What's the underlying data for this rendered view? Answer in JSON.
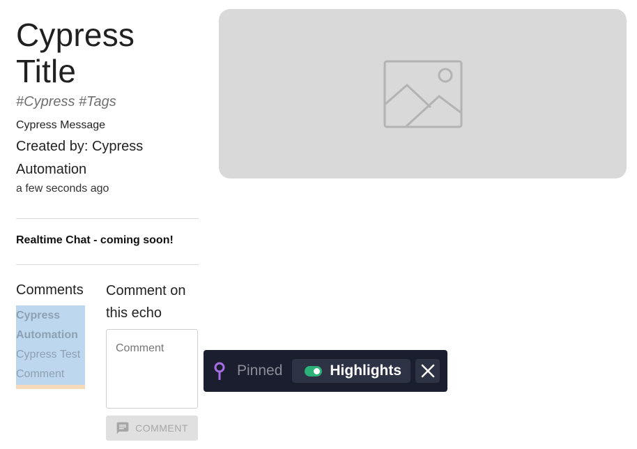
{
  "post": {
    "title": "Cypress Title",
    "tags": "#Cypress #Tags",
    "message": "Cypress Message",
    "created_by": "Created by: Cypress Automation",
    "time_ago": "a few seconds ago"
  },
  "chat": {
    "notice": "Realtime Chat - coming soon!"
  },
  "comments": {
    "heading": "Comments",
    "items": [
      {
        "author": "Cypress Automation",
        "text": "Cypress Test Comment"
      }
    ],
    "compose_heading": "Comment on this echo",
    "input_placeholder": "Comment",
    "submit_label": "COMMENT",
    "submit_icon": "comment-icon"
  },
  "media": {
    "placeholder_icon": "image-icon",
    "background": "#d9d9d9"
  },
  "pin_toolbar": {
    "pin_icon": "pin-icon",
    "pinned_label": "Pinned",
    "highlights_label": "Highlights",
    "highlights_enabled": true,
    "close_icon": "close-icon",
    "background": "#1b1e2e",
    "accent": "#2cb178"
  }
}
